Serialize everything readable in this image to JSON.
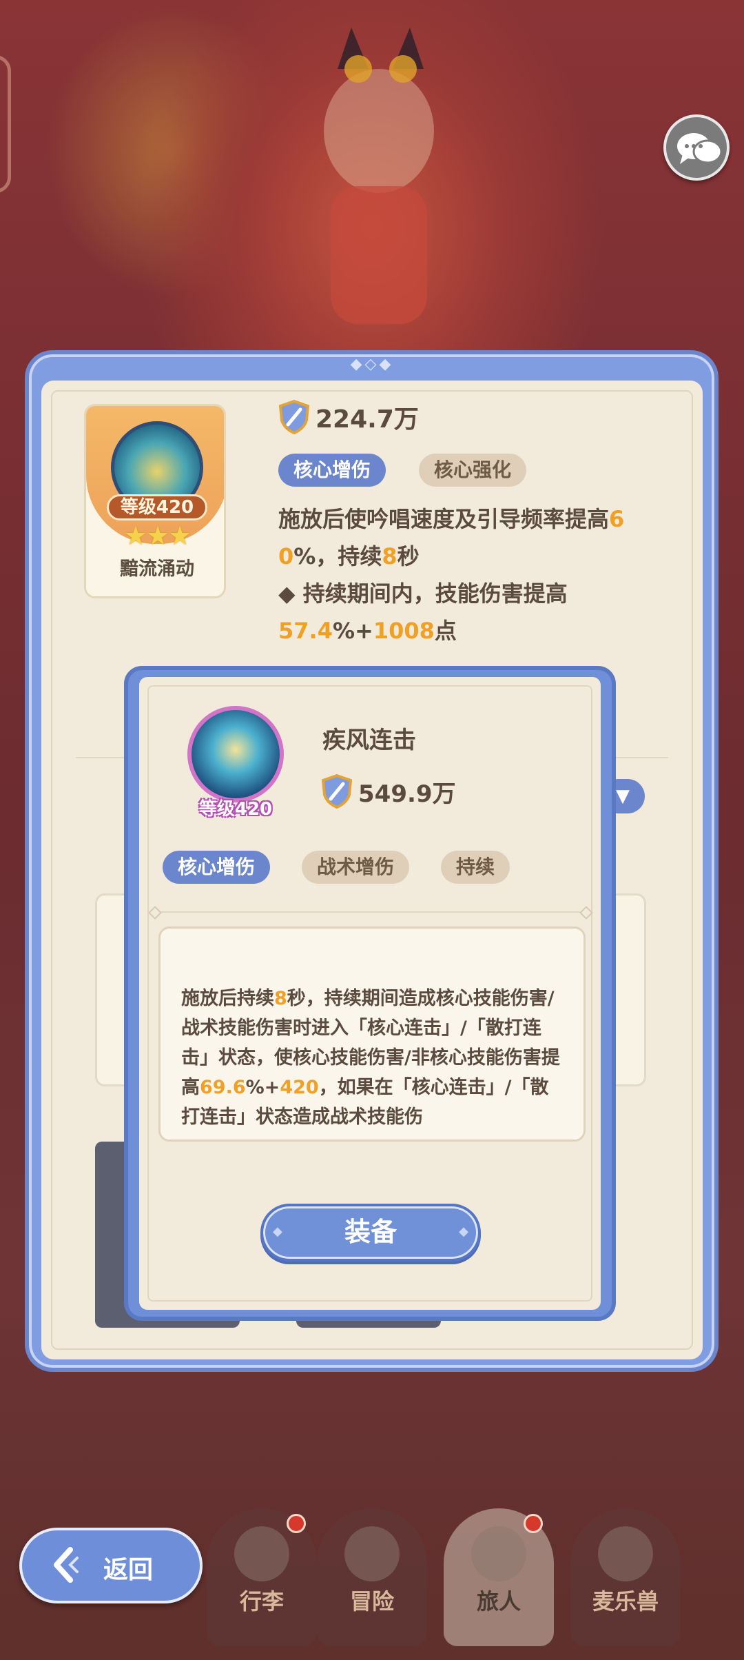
{
  "core": {
    "level": "等级420",
    "stars": "★★★",
    "name": "黯流涌动",
    "power": "224.7万",
    "tags": [
      "核心增伤",
      "核心强化"
    ],
    "desc_line1_a": "施放后使吟唱速度及引导频率提高",
    "desc_line1_b": "6",
    "desc_line2_a": "0",
    "desc_line2_b": "%，持续",
    "desc_line2_c": "8",
    "desc_line2_d": "秒",
    "desc_line3": "◆ 持续期间内，技能伤害提高",
    "desc_line4_a": "57.4",
    "desc_line4_b": "%+",
    "desc_line4_c": "1008",
    "desc_line4_d": "点"
  },
  "skill": {
    "name": "疾风连击",
    "level": "等级420",
    "power": "549.9万",
    "tags": [
      "核心增伤",
      "战术增伤",
      "持续"
    ],
    "desc_a": "施放后持续",
    "desc_b": "8",
    "desc_c": "秒，持续期间造成核心技能伤害/战术技能伤害时进入「核心连击」/「散打连击」状态，使核心技能伤害/非核心技能伤害提高",
    "desc_d": "69.6",
    "desc_e": "%+",
    "desc_f": "420",
    "desc_g": "，如果在「核心连击」/「散打连击」状态造成战术技能伤",
    "equip_label": "装备"
  },
  "nav": {
    "back_label": "返回",
    "items": [
      "行李",
      "冒险",
      "旅人",
      "麦乐兽"
    ]
  },
  "icons": {
    "chat": "chat-bubbles-icon",
    "power": "shield-sword-icon",
    "back": "back-arrow-icon"
  },
  "colors": {
    "accent_blue": "#6b86cc",
    "highlight_orange": "#f0a024",
    "panel_beige": "#f2ebdc"
  }
}
